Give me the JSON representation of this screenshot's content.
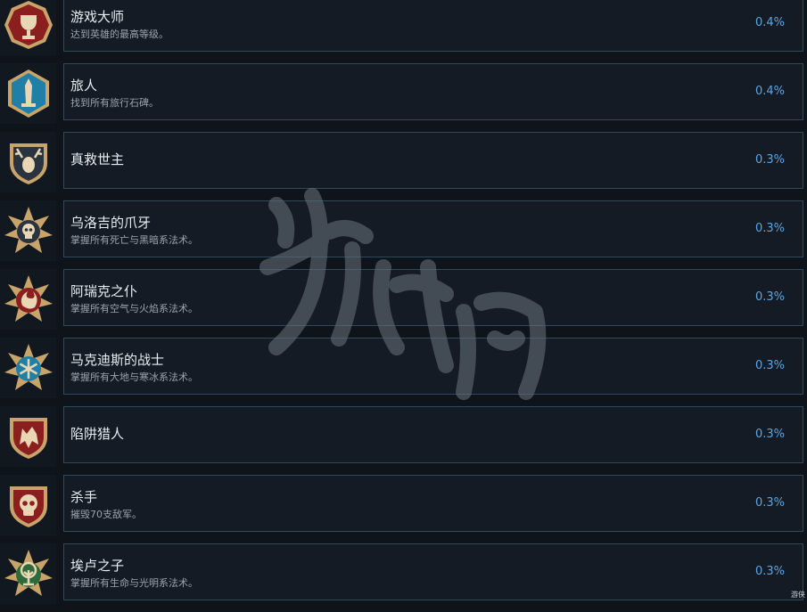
{
  "achievements": [
    {
      "title": "游戏大师",
      "description": "达到英雄的最高等级。",
      "percent": "0.4%",
      "icon": "trophy-icon",
      "color": "#8b1e1e"
    },
    {
      "title": "旅人",
      "description": "找到所有旅行石碑。",
      "percent": "0.4%",
      "icon": "obelisk-icon",
      "color": "#1f7fa6"
    },
    {
      "title": "真救世主",
      "description": "",
      "percent": "0.3%",
      "icon": "stag-shield-icon",
      "color": "#2a3340"
    },
    {
      "title": "乌洛吉的爪牙",
      "description": "掌握所有死亡与黑暗系法术。",
      "percent": "0.3%",
      "icon": "skull-sun-icon",
      "color": "#2a3340"
    },
    {
      "title": "阿瑞克之仆",
      "description": "掌握所有空气与火焰系法术。",
      "percent": "0.3%",
      "icon": "flame-swirl-icon",
      "color": "#8b1e1e"
    },
    {
      "title": "马克迪斯的战士",
      "description": "掌握所有大地与寒冰系法术。",
      "percent": "0.3%",
      "icon": "snowflake-icon",
      "color": "#1f7fa6"
    },
    {
      "title": "陷阱猎人",
      "description": "",
      "percent": "0.3%",
      "icon": "wolf-shield-icon",
      "color": "#8b1e1e"
    },
    {
      "title": "杀手",
      "description": "摧毁70支敌军。",
      "percent": "0.3%",
      "icon": "skull-shield-icon",
      "color": "#8b1e1e"
    },
    {
      "title": "埃卢之子",
      "description": "掌握所有生命与光明系法术。",
      "percent": "0.3%",
      "icon": "tree-icon",
      "color": "#2f6b3a"
    }
  ],
  "corner_text": "游侠"
}
